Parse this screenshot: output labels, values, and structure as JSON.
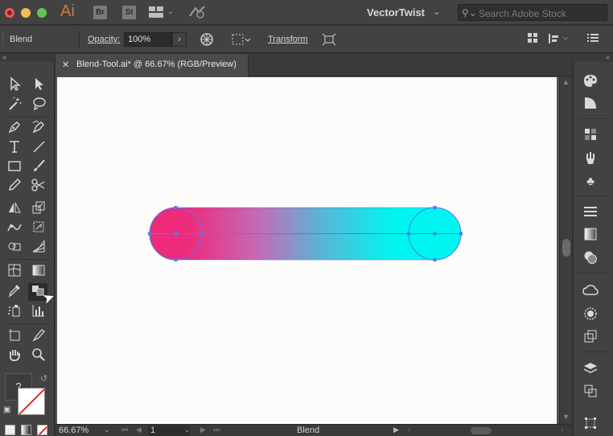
{
  "titlebar": {
    "app_logo": "Ai",
    "bridge_label": "Br",
    "stock_label": "St",
    "workspace": "VectorTwist",
    "search_placeholder": "Search Adobe Stock"
  },
  "control_bar": {
    "selection_type": "Blend",
    "opacity_label": "Opacity:",
    "opacity_value": "100%",
    "transform_label": "Transform"
  },
  "document": {
    "tab_title": "Blend-Tool.ai* @ 66.67% (RGB/Preview)"
  },
  "artwork": {
    "start_color": "#ee2a7b",
    "end_color": "#00f5f0",
    "path_color": "#4a7df0"
  },
  "status_bar": {
    "zoom": "66.67%",
    "artboard_number": "1",
    "current_tool": "Blend"
  },
  "tools": {
    "fill_label": "?"
  }
}
